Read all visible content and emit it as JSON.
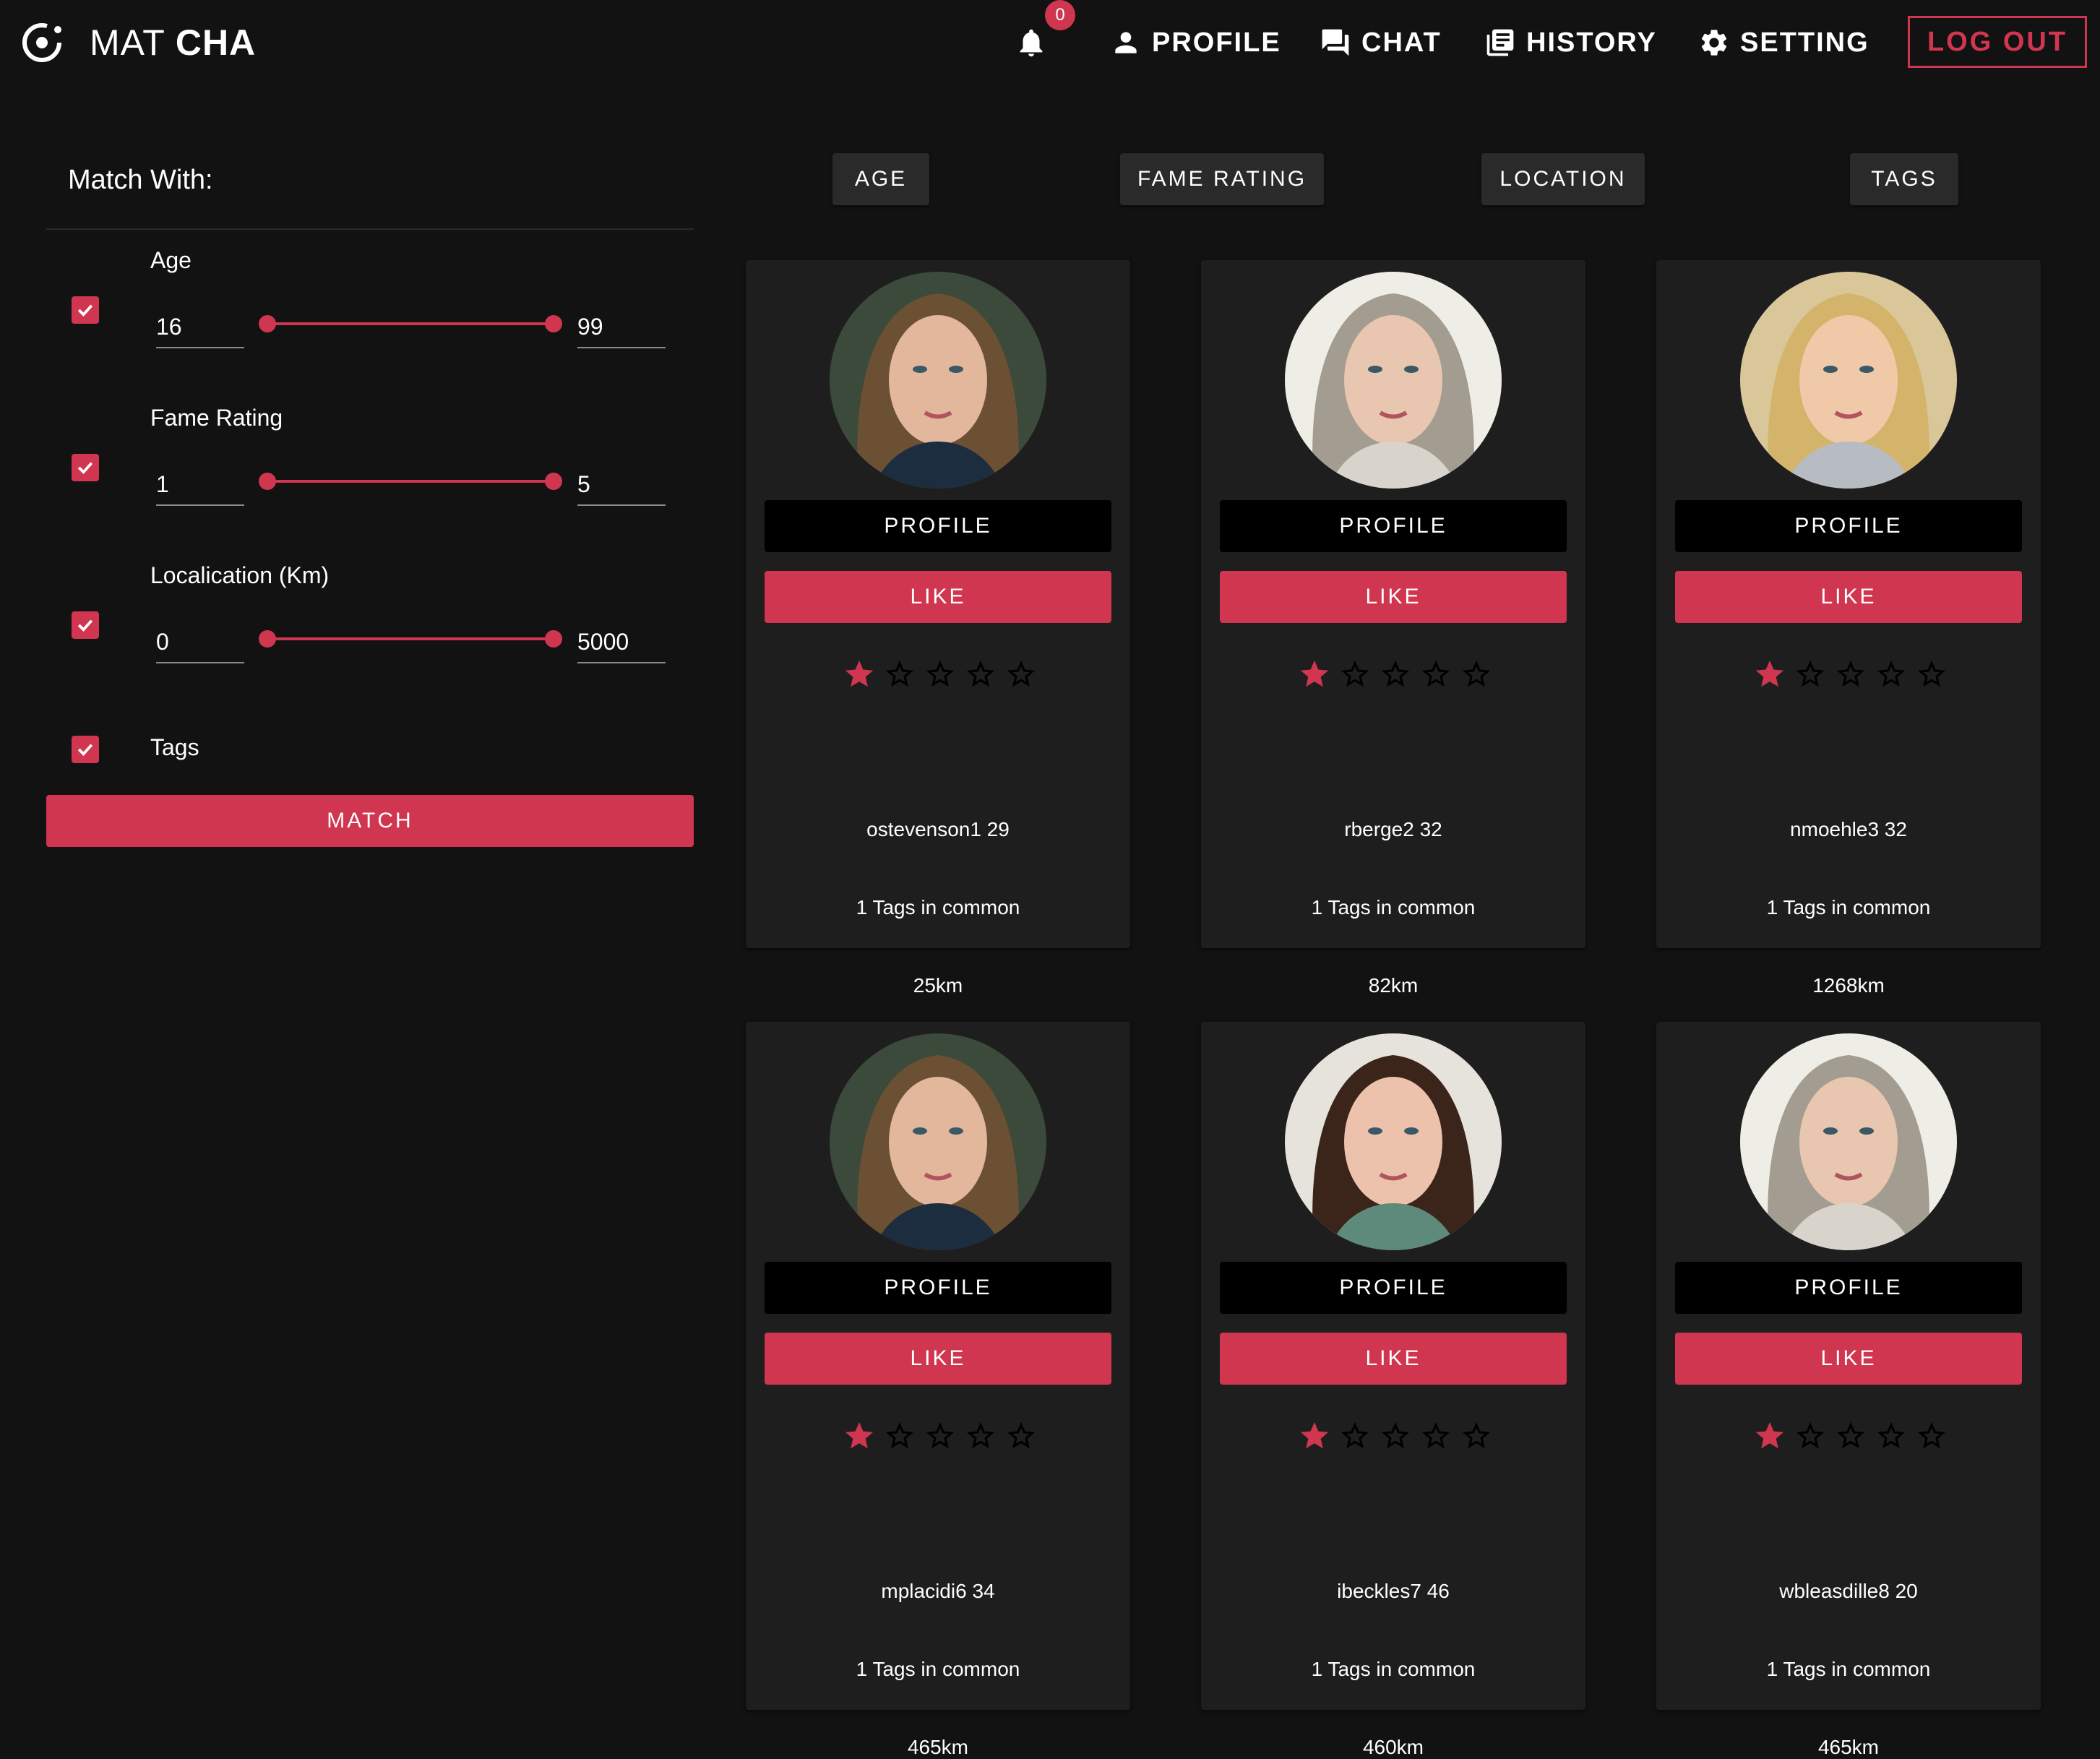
{
  "brand": {
    "light": "MAT",
    "bold": "CHA"
  },
  "notifications": {
    "count": "0"
  },
  "nav": {
    "profile": "PROFILE",
    "chat": "CHAT",
    "history": "HISTORY",
    "setting": "SETTING",
    "logout": "LOG OUT"
  },
  "colors": {
    "accent": "#d0364f",
    "background": "#121212",
    "card": "#1e1e1e"
  },
  "filter": {
    "title": "Match With:",
    "age": {
      "label": "Age",
      "min": "16",
      "max": "99",
      "enabled": true
    },
    "fame": {
      "label": "Fame Rating",
      "min": "1",
      "max": "5",
      "enabled": true
    },
    "location": {
      "label": "Localication (Km)",
      "min": "0",
      "max": "5000",
      "enabled": true
    },
    "tags": {
      "label": "Tags",
      "enabled": true
    },
    "match_button": "MATCH"
  },
  "sort": {
    "age": "AGE",
    "fame": "FAME RATING",
    "location": "LOCATION",
    "tags": "TAGS"
  },
  "cards": [
    {
      "name": "ostevenson1 29",
      "tags": "1 Tags in common",
      "distance": "25km",
      "rating": 1,
      "profile": "PROFILE",
      "like": "LIKE"
    },
    {
      "name": "rberge2 32",
      "tags": "1 Tags in common",
      "distance": "82km",
      "rating": 1,
      "profile": "PROFILE",
      "like": "LIKE"
    },
    {
      "name": "nmoehle3 32",
      "tags": "1 Tags in common",
      "distance": "1268km",
      "rating": 1,
      "profile": "PROFILE",
      "like": "LIKE"
    },
    {
      "name": "mplacidi6 34",
      "tags": "1 Tags in common",
      "distance": "465km",
      "rating": 1,
      "profile": "PROFILE",
      "like": "LIKE"
    },
    {
      "name": "ibeckles7 46",
      "tags": "1 Tags in common",
      "distance": "460km",
      "rating": 1,
      "profile": "PROFILE",
      "like": "LIKE"
    },
    {
      "name": "wbleasdille8 20",
      "tags": "1 Tags in common",
      "distance": "465km",
      "rating": 1,
      "profile": "PROFILE",
      "like": "LIKE"
    }
  ]
}
